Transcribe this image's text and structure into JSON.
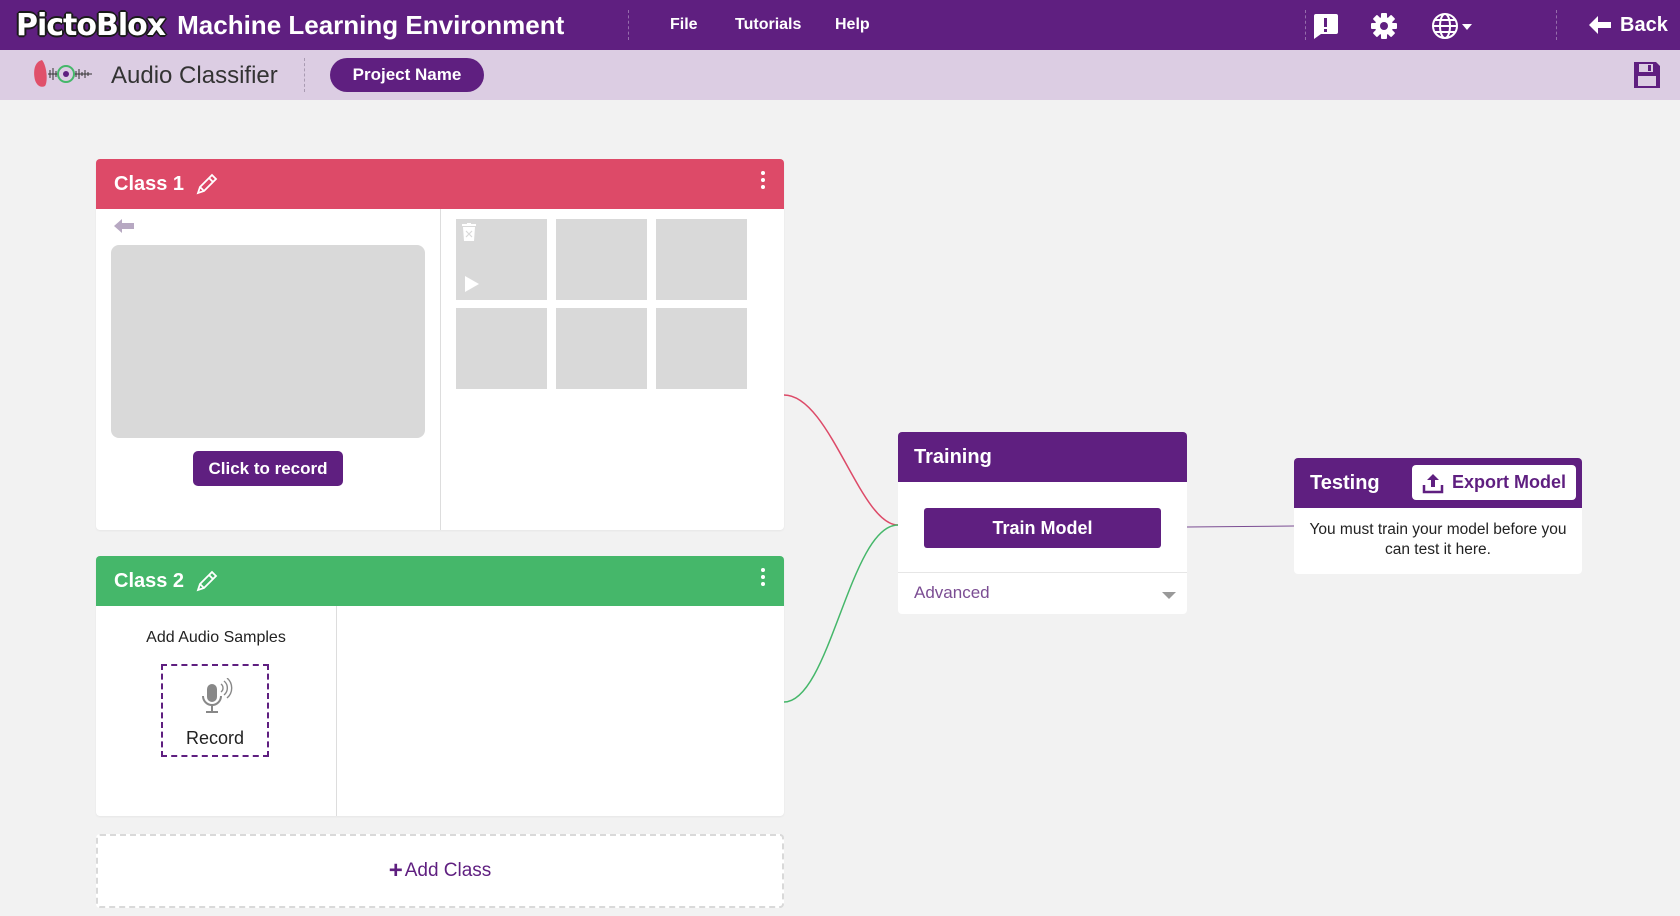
{
  "topbar": {
    "logo_text": "PictoBlox",
    "title": "Machine Learning Environment",
    "menu": [
      {
        "label": "File"
      },
      {
        "label": "Tutorials"
      },
      {
        "label": "Help"
      }
    ],
    "icons": [
      "feedback-icon",
      "gear-icon",
      "globe-icon"
    ],
    "back_label": "Back"
  },
  "subbar": {
    "title": "Audio Classifier",
    "project_button": "Project Name",
    "save_icon": "save-icon"
  },
  "classes": [
    {
      "name": "Class 1",
      "color": "#dd4a68",
      "record_button": "Click to record"
    },
    {
      "name": "Class 2",
      "color": "#45b76a",
      "add_samples_label": "Add Audio Samples",
      "record_label": "Record"
    }
  ],
  "add_class": {
    "label": "Add Class"
  },
  "training": {
    "title": "Training",
    "train_button": "Train Model",
    "advanced_label": "Advanced"
  },
  "testing": {
    "title": "Testing",
    "export_button": "Export Model",
    "message": "You must train your model before you can test it here."
  },
  "colors": {
    "primary": "#5f1f80",
    "subbar": "#dccde3",
    "class1": "#dd4a68",
    "class2": "#45b76a",
    "background": "#f2f2f2"
  }
}
